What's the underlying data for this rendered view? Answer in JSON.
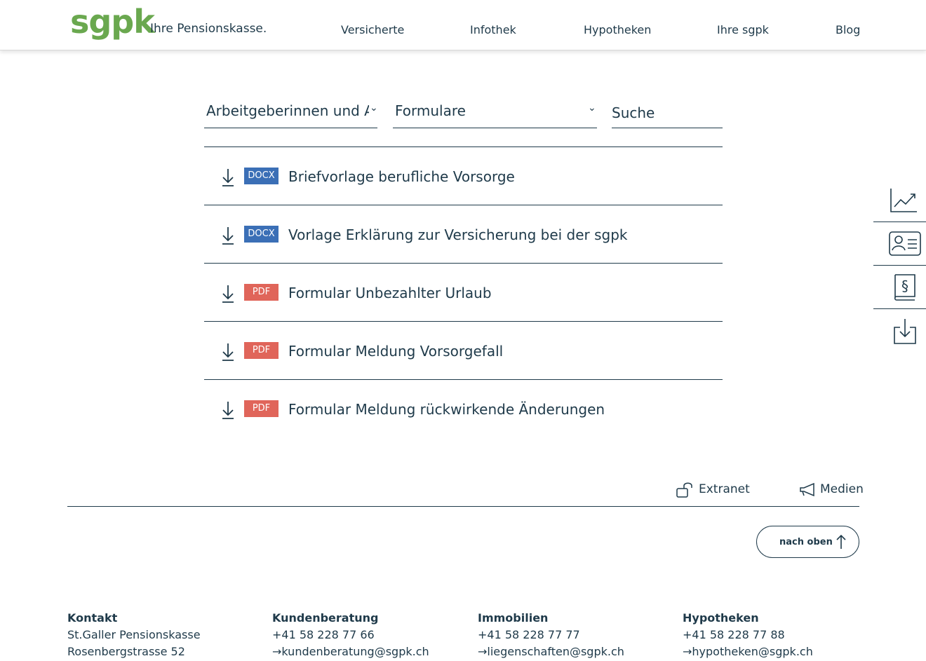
{
  "brand": {
    "logo": "sgpk",
    "tagline": "Ihre Pensionskasse."
  },
  "nav": [
    "Versicherte",
    "Infothek",
    "Hypotheken",
    "Ihre sgpk",
    "Blog"
  ],
  "filters": {
    "audience": "Arbeitgeberinnen und Arb",
    "category": "Formulare",
    "search_placeholder": "Suche"
  },
  "documents": [
    {
      "type": "DOCX",
      "title": "Briefvorlage berufliche Vorsorge"
    },
    {
      "type": "DOCX",
      "title": "Vorlage Erklärung zur Versicherung bei der sgpk"
    },
    {
      "type": "PDF",
      "title": "Formular Unbezahlter Urlaub"
    },
    {
      "type": "PDF",
      "title": "Formular Meldung Vorsorgefall"
    },
    {
      "type": "PDF",
      "title": "Formular Meldung rückwirkende Änderungen"
    }
  ],
  "badge_colors": {
    "DOCX": "#3b6fb6",
    "PDF": "#e0655a"
  },
  "side_tools": [
    "chart-icon",
    "contact-card-icon",
    "paragraph-book-icon",
    "download-box-icon"
  ],
  "util_links": {
    "extranet": "Extranet",
    "medien": "Medien"
  },
  "to_top": "nach oben",
  "footer": {
    "kontakt": {
      "head": "Kontakt",
      "line1": "St.Galler Pensionskasse",
      "line2": "Rosenbergstrasse 52"
    },
    "kundenberatung": {
      "head": "Kundenberatung",
      "phone": "+41 58 228 77 66",
      "email": "kundenberatung@sgpk.ch"
    },
    "immobilien": {
      "head": "Immobilien",
      "phone": "+41 58 228 77 77",
      "email": "liegenschaften@sgpk.ch"
    },
    "hypotheken": {
      "head": "Hypotheken",
      "phone": "+41 58 228 77 88",
      "email": "hypotheken@sgpk.ch"
    }
  },
  "colors": {
    "brand_green": "#6aa84f",
    "text": "#1f3a4a"
  }
}
